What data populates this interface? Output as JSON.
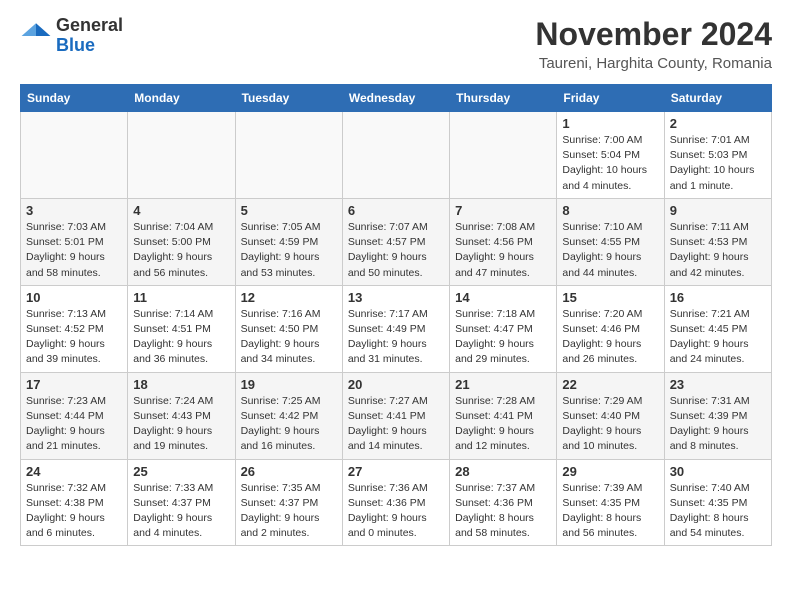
{
  "header": {
    "logo_general": "General",
    "logo_blue": "Blue",
    "title": "November 2024",
    "subtitle": "Taureni, Harghita County, Romania"
  },
  "columns": [
    "Sunday",
    "Monday",
    "Tuesday",
    "Wednesday",
    "Thursday",
    "Friday",
    "Saturday"
  ],
  "weeks": [
    [
      {
        "day": "",
        "sunrise": "",
        "sunset": "",
        "daylight": ""
      },
      {
        "day": "",
        "sunrise": "",
        "sunset": "",
        "daylight": ""
      },
      {
        "day": "",
        "sunrise": "",
        "sunset": "",
        "daylight": ""
      },
      {
        "day": "",
        "sunrise": "",
        "sunset": "",
        "daylight": ""
      },
      {
        "day": "",
        "sunrise": "",
        "sunset": "",
        "daylight": ""
      },
      {
        "day": "1",
        "sunrise": "Sunrise: 7:00 AM",
        "sunset": "Sunset: 5:04 PM",
        "daylight": "Daylight: 10 hours and 4 minutes."
      },
      {
        "day": "2",
        "sunrise": "Sunrise: 7:01 AM",
        "sunset": "Sunset: 5:03 PM",
        "daylight": "Daylight: 10 hours and 1 minute."
      }
    ],
    [
      {
        "day": "3",
        "sunrise": "Sunrise: 7:03 AM",
        "sunset": "Sunset: 5:01 PM",
        "daylight": "Daylight: 9 hours and 58 minutes."
      },
      {
        "day": "4",
        "sunrise": "Sunrise: 7:04 AM",
        "sunset": "Sunset: 5:00 PM",
        "daylight": "Daylight: 9 hours and 56 minutes."
      },
      {
        "day": "5",
        "sunrise": "Sunrise: 7:05 AM",
        "sunset": "Sunset: 4:59 PM",
        "daylight": "Daylight: 9 hours and 53 minutes."
      },
      {
        "day": "6",
        "sunrise": "Sunrise: 7:07 AM",
        "sunset": "Sunset: 4:57 PM",
        "daylight": "Daylight: 9 hours and 50 minutes."
      },
      {
        "day": "7",
        "sunrise": "Sunrise: 7:08 AM",
        "sunset": "Sunset: 4:56 PM",
        "daylight": "Daylight: 9 hours and 47 minutes."
      },
      {
        "day": "8",
        "sunrise": "Sunrise: 7:10 AM",
        "sunset": "Sunset: 4:55 PM",
        "daylight": "Daylight: 9 hours and 44 minutes."
      },
      {
        "day": "9",
        "sunrise": "Sunrise: 7:11 AM",
        "sunset": "Sunset: 4:53 PM",
        "daylight": "Daylight: 9 hours and 42 minutes."
      }
    ],
    [
      {
        "day": "10",
        "sunrise": "Sunrise: 7:13 AM",
        "sunset": "Sunset: 4:52 PM",
        "daylight": "Daylight: 9 hours and 39 minutes."
      },
      {
        "day": "11",
        "sunrise": "Sunrise: 7:14 AM",
        "sunset": "Sunset: 4:51 PM",
        "daylight": "Daylight: 9 hours and 36 minutes."
      },
      {
        "day": "12",
        "sunrise": "Sunrise: 7:16 AM",
        "sunset": "Sunset: 4:50 PM",
        "daylight": "Daylight: 9 hours and 34 minutes."
      },
      {
        "day": "13",
        "sunrise": "Sunrise: 7:17 AM",
        "sunset": "Sunset: 4:49 PM",
        "daylight": "Daylight: 9 hours and 31 minutes."
      },
      {
        "day": "14",
        "sunrise": "Sunrise: 7:18 AM",
        "sunset": "Sunset: 4:47 PM",
        "daylight": "Daylight: 9 hours and 29 minutes."
      },
      {
        "day": "15",
        "sunrise": "Sunrise: 7:20 AM",
        "sunset": "Sunset: 4:46 PM",
        "daylight": "Daylight: 9 hours and 26 minutes."
      },
      {
        "day": "16",
        "sunrise": "Sunrise: 7:21 AM",
        "sunset": "Sunset: 4:45 PM",
        "daylight": "Daylight: 9 hours and 24 minutes."
      }
    ],
    [
      {
        "day": "17",
        "sunrise": "Sunrise: 7:23 AM",
        "sunset": "Sunset: 4:44 PM",
        "daylight": "Daylight: 9 hours and 21 minutes."
      },
      {
        "day": "18",
        "sunrise": "Sunrise: 7:24 AM",
        "sunset": "Sunset: 4:43 PM",
        "daylight": "Daylight: 9 hours and 19 minutes."
      },
      {
        "day": "19",
        "sunrise": "Sunrise: 7:25 AM",
        "sunset": "Sunset: 4:42 PM",
        "daylight": "Daylight: 9 hours and 16 minutes."
      },
      {
        "day": "20",
        "sunrise": "Sunrise: 7:27 AM",
        "sunset": "Sunset: 4:41 PM",
        "daylight": "Daylight: 9 hours and 14 minutes."
      },
      {
        "day": "21",
        "sunrise": "Sunrise: 7:28 AM",
        "sunset": "Sunset: 4:41 PM",
        "daylight": "Daylight: 9 hours and 12 minutes."
      },
      {
        "day": "22",
        "sunrise": "Sunrise: 7:29 AM",
        "sunset": "Sunset: 4:40 PM",
        "daylight": "Daylight: 9 hours and 10 minutes."
      },
      {
        "day": "23",
        "sunrise": "Sunrise: 7:31 AM",
        "sunset": "Sunset: 4:39 PM",
        "daylight": "Daylight: 9 hours and 8 minutes."
      }
    ],
    [
      {
        "day": "24",
        "sunrise": "Sunrise: 7:32 AM",
        "sunset": "Sunset: 4:38 PM",
        "daylight": "Daylight: 9 hours and 6 minutes."
      },
      {
        "day": "25",
        "sunrise": "Sunrise: 7:33 AM",
        "sunset": "Sunset: 4:37 PM",
        "daylight": "Daylight: 9 hours and 4 minutes."
      },
      {
        "day": "26",
        "sunrise": "Sunrise: 7:35 AM",
        "sunset": "Sunset: 4:37 PM",
        "daylight": "Daylight: 9 hours and 2 minutes."
      },
      {
        "day": "27",
        "sunrise": "Sunrise: 7:36 AM",
        "sunset": "Sunset: 4:36 PM",
        "daylight": "Daylight: 9 hours and 0 minutes."
      },
      {
        "day": "28",
        "sunrise": "Sunrise: 7:37 AM",
        "sunset": "Sunset: 4:36 PM",
        "daylight": "Daylight: 8 hours and 58 minutes."
      },
      {
        "day": "29",
        "sunrise": "Sunrise: 7:39 AM",
        "sunset": "Sunset: 4:35 PM",
        "daylight": "Daylight: 8 hours and 56 minutes."
      },
      {
        "day": "30",
        "sunrise": "Sunrise: 7:40 AM",
        "sunset": "Sunset: 4:35 PM",
        "daylight": "Daylight: 8 hours and 54 minutes."
      }
    ]
  ]
}
